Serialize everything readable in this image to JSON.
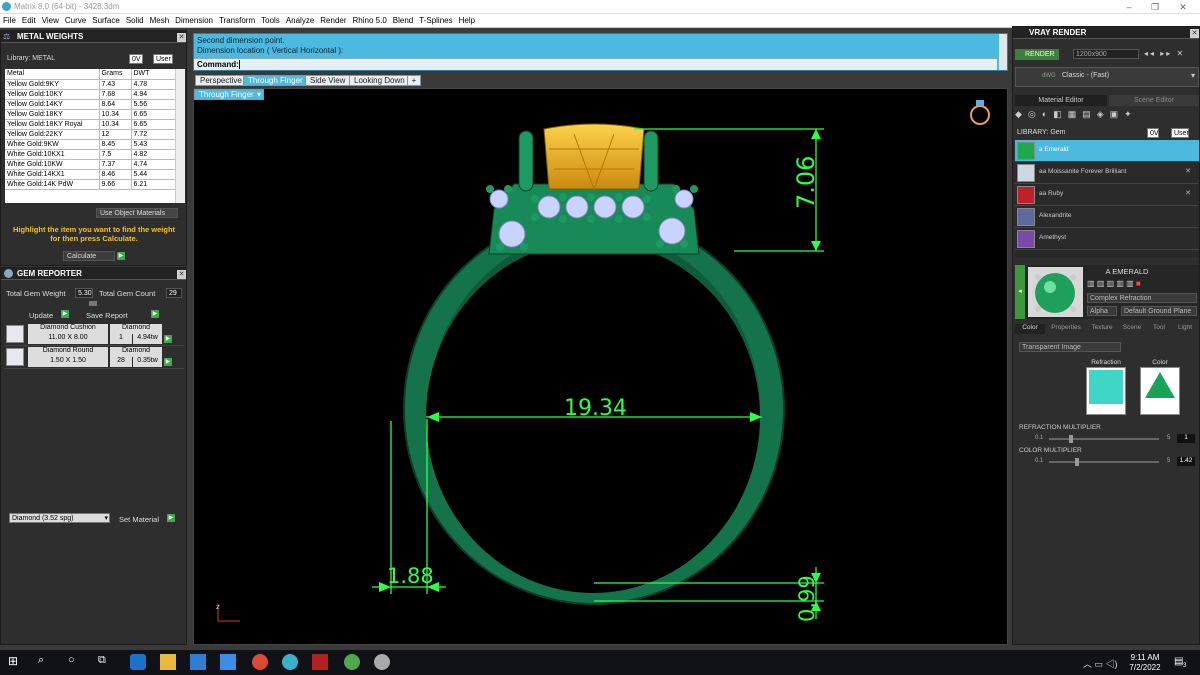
{
  "window": {
    "title": "Matrix 8.0 (64-bit) - 3428.3dm",
    "min": "–",
    "max": "❐",
    "close": "✕"
  },
  "menu": [
    "File",
    "Edit",
    "View",
    "Curve",
    "Surface",
    "Solid",
    "Mesh",
    "Dimension",
    "Transform",
    "Tools",
    "Analyze",
    "Render",
    "Rhino 5.0",
    "Blend",
    "T-Splines",
    "Help"
  ],
  "metal_weights": {
    "title": "METAL WEIGHTS",
    "library_label": "Library: METAL",
    "lib_btn1": "0V",
    "lib_btn2": "User",
    "columns": [
      "Metal",
      "Grams",
      "DWT"
    ],
    "rows": [
      [
        "Yellow Gold:9KY",
        "7.43",
        "4.78"
      ],
      [
        "Yellow Gold:10KY",
        "7.68",
        "4.94"
      ],
      [
        "Yellow Gold:14KY",
        "8.64",
        "5.56"
      ],
      [
        "Yellow Gold:18KY",
        "10.34",
        "6.65"
      ],
      [
        "Yellow Gold:18KY Royal",
        "10.34",
        "6.65"
      ],
      [
        "Yellow Gold:22KY",
        "12",
        "7.72"
      ],
      [
        "White Gold:9KW",
        "8.45",
        "5.43"
      ],
      [
        "White Gold:10KX1",
        "7.5",
        "4.82"
      ],
      [
        "White Gold:10KW",
        "7.37",
        "4.74"
      ],
      [
        "White Gold:14KX1",
        "8.46",
        "5.44"
      ],
      [
        "White Gold:14K PdW",
        "9.66",
        "6.21"
      ]
    ],
    "use_object_materials": "Use Object Materials",
    "hint": "Highlight the item you want to find the weight for then press Calculate.",
    "calculate": "Calculate"
  },
  "gem_reporter": {
    "title": "GEM REPORTER",
    "total_weight_label": "Total Gem Weight",
    "total_weight": "5.30",
    "total_count_label": "Total Gem Count",
    "total_count": "29",
    "update": "Update",
    "save_report": "Save Report",
    "gems": [
      {
        "cut": "Diamond Cushion",
        "type": "Diamond",
        "size": "11.00 X 8.00",
        "count": "1",
        "weight": "4.94tw"
      },
      {
        "cut": "Diamond Round",
        "type": "Diamond",
        "size": "1.50 X 1.50",
        "count": "28",
        "weight": "0.35tw"
      }
    ],
    "material_select": "Diamond      (3.52 spg)",
    "set_material": "Set Material"
  },
  "command": {
    "line1": "Second dimension point.",
    "line2": "Dimension location ( Vertical  Horizontal ):",
    "prompt": "Command:"
  },
  "viewport_tabs": [
    "Perspective",
    "Through Finger",
    "Side View",
    "Looking Down"
  ],
  "viewport_tabs_active": 1,
  "viewport_label": "Through Finger",
  "dimensions": {
    "height": "7.06",
    "inner_diameter": "19.34",
    "shank_width": "1.88",
    "shank_bottom": "0.99"
  },
  "axis_label": "z",
  "vray": {
    "title": "VRAY RENDER",
    "render": "RENDER",
    "resolution": "1200x900",
    "preset_prefix": "dWG",
    "preset": "Classic - (Fast)",
    "tabs": [
      "Material Editor",
      "Scene Editor"
    ],
    "library_label": "LIBRARY: Gem",
    "lib_btn1": "0V",
    "lib_btn2": "User",
    "materials": [
      {
        "name": "a Emerald",
        "color": "#1fa84e"
      },
      {
        "name": "aa Moissanite Forever Brilliant",
        "color": "#cfd8e0"
      },
      {
        "name": "aa Ruby",
        "color": "#c0202a"
      },
      {
        "name": "Alexandrite",
        "color": "#5c6aa0"
      },
      {
        "name": "Amethyst",
        "color": "#7a4aa8"
      }
    ],
    "selected_name": "A EMERALD",
    "mat_type": "Complex Refraction",
    "alpha_label": "Alpha",
    "ground": "Default Ground Plane",
    "subtabs": [
      "Color",
      "Properties",
      "Texture",
      "Scene",
      "Tool",
      "Light"
    ],
    "transparent_select": "Transparent Image",
    "refraction_label": "Refraction",
    "color_label": "Color",
    "refraction_multiplier": {
      "label": "REFRACTION MULTIPLIER",
      "min": "0.1",
      "max": "5",
      "value": "1"
    },
    "color_multiplier": {
      "label": "COLOR MULTIPLIER",
      "min": "0.1",
      "max": "5",
      "value": "1.42"
    }
  },
  "taskbar": {
    "time": "9:11 AM",
    "date": "7/2/2022",
    "notif": "3"
  }
}
